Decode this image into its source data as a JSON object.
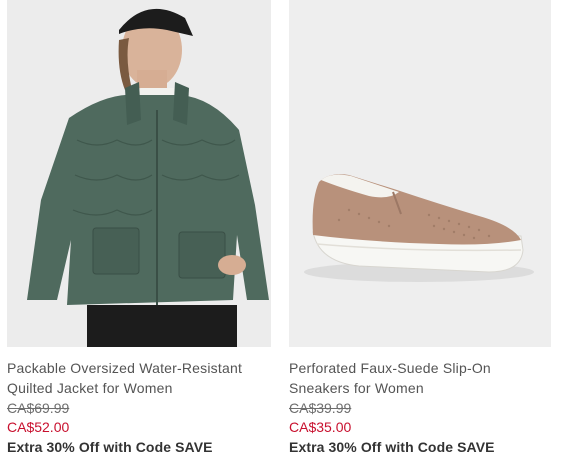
{
  "products": [
    {
      "title_line1": "Packable Oversized Water-Resistant",
      "title_line2": "Quilted Jacket for Women",
      "was_price": "CA$69.99",
      "now_price": "CA$52.00",
      "promo": "Extra 30% Off with Code SAVE",
      "image_icon": "quilted-jacket-photo"
    },
    {
      "title_line1": "Perforated Faux-Suede Slip-On",
      "title_line2": "Sneakers for Women",
      "was_price": "CA$39.99",
      "now_price": "CA$35.00",
      "promo": "Extra 30% Off with Code SAVE",
      "image_icon": "slip-on-sneaker-photo"
    }
  ],
  "colors": {
    "sale_red": "#c8102e",
    "jacket_green": "#4f6a5e",
    "sneaker_tan": "#b8917b",
    "image_bg": "#eeeeee"
  }
}
